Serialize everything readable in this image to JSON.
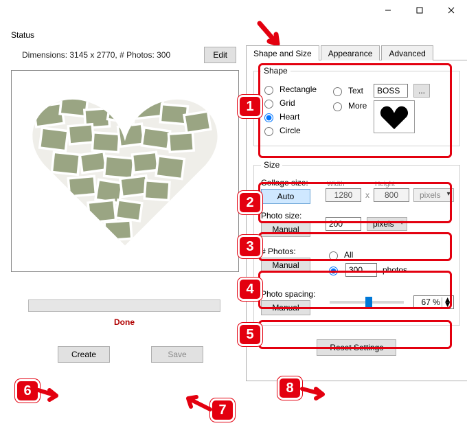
{
  "window": {
    "controls": {
      "minimize": "–",
      "maximize": "☐",
      "close": "✕"
    }
  },
  "status": {
    "label": "Status",
    "dimensions_text": "Dimensions: 3145 x 2770, # Photos: 300",
    "edit_label": "Edit",
    "done_label": "Done"
  },
  "buttons": {
    "create": "Create",
    "save": "Save",
    "reset": "Reset Settings"
  },
  "tabs": {
    "shape_and_size": "Shape and Size",
    "appearance": "Appearance",
    "advanced": "Advanced"
  },
  "shape": {
    "legend": "Shape",
    "rectangle": "Rectangle",
    "grid": "Grid",
    "heart": "Heart",
    "circle": "Circle",
    "text": "Text",
    "text_value": "BOSS",
    "more": "More",
    "dots": "..."
  },
  "size": {
    "legend": "Size",
    "collage_size_label": "Collage size:",
    "collage_mode": "Auto",
    "width_label": "Width",
    "height_label": "Height",
    "width": "1280",
    "height": "800",
    "x": "x",
    "units": "pixels"
  },
  "photo_size": {
    "label": "Photo size:",
    "mode": "Manual",
    "value": "200",
    "units": "pixels"
  },
  "photo_count": {
    "label": "# Photos:",
    "mode": "Manual",
    "all": "All",
    "value": "300",
    "suffix": "photos"
  },
  "spacing": {
    "label": "Photo spacing:",
    "mode": "Manual",
    "value": "67 %"
  },
  "annotations": {
    "n1": "1",
    "n2": "2",
    "n3": "3",
    "n4": "4",
    "n5": "5",
    "n6": "6",
    "n7": "7",
    "n8": "8"
  }
}
